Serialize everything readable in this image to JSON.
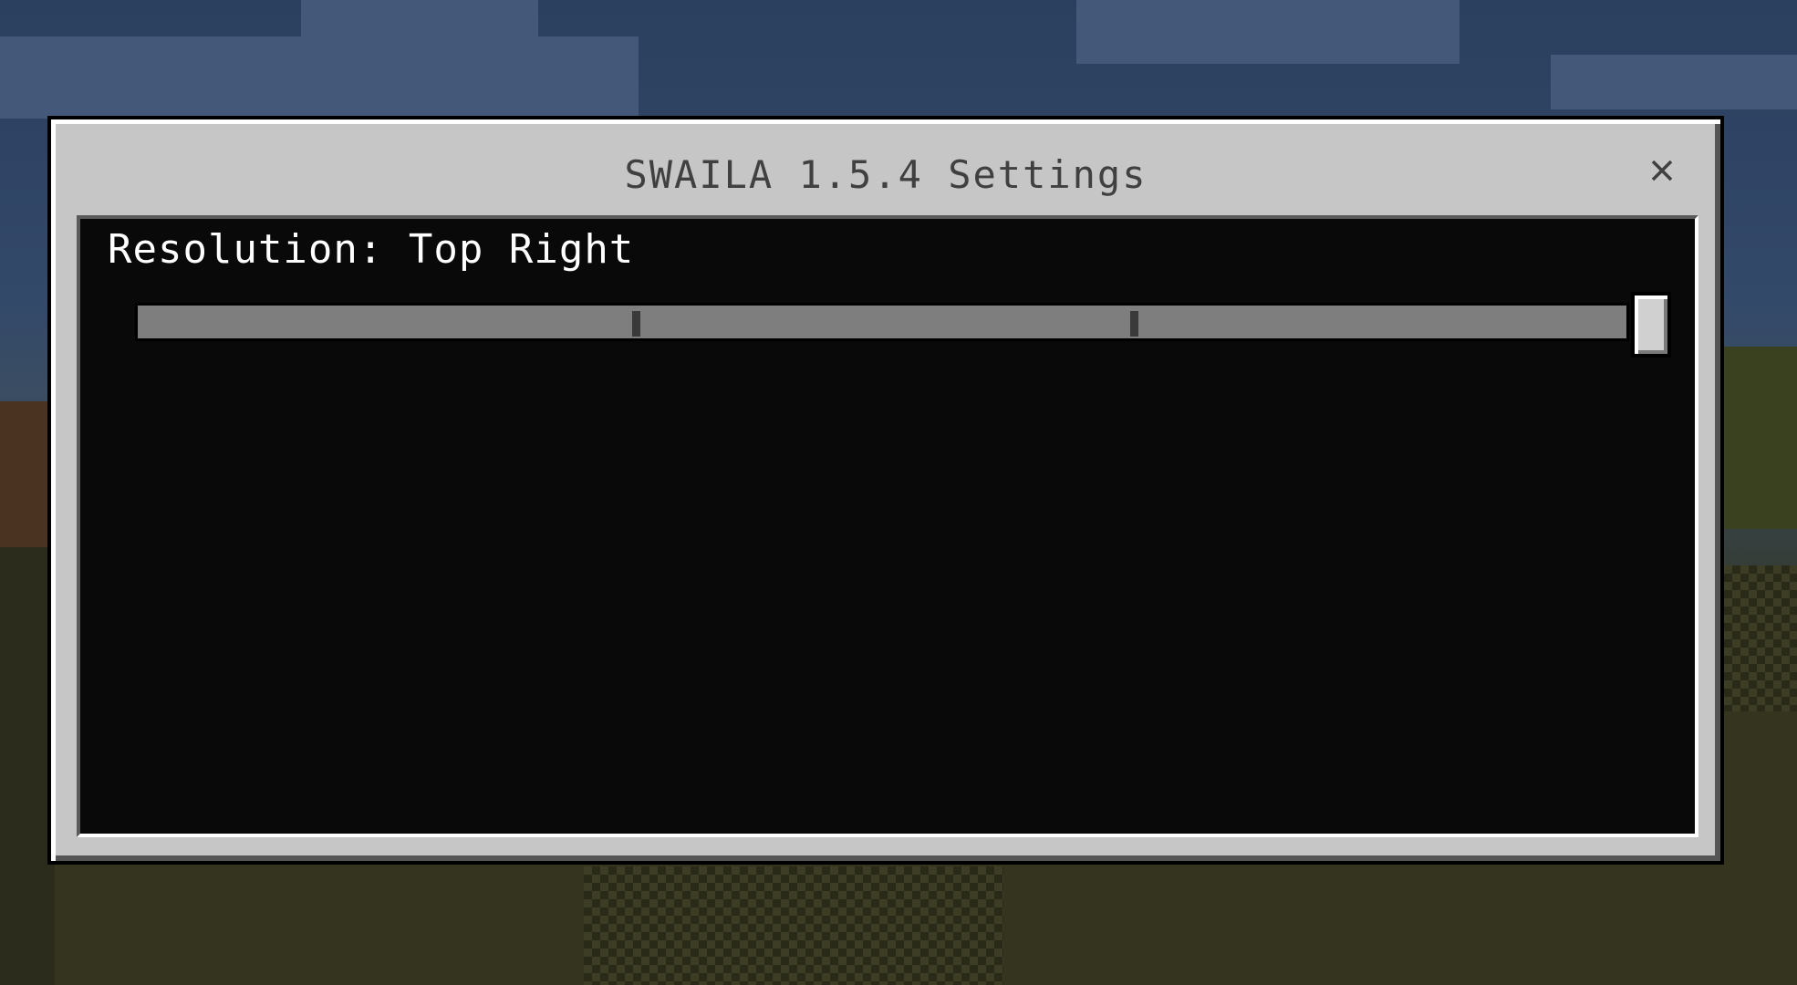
{
  "dialog": {
    "title": "SWAILA 1.5.4 Settings",
    "close_icon": "close-icon"
  },
  "setting": {
    "label": "Resolution: Top Right",
    "slider": {
      "steps": 4,
      "selected_index": 3,
      "value_fraction": 1.0
    }
  },
  "colors": {
    "dialog_bg": "#c6c6c6",
    "panel_bg": "#090909",
    "title_text": "#404040",
    "label_text": "#ffffff",
    "track": "#7e7e7e",
    "thumb": "#d0d0d0"
  }
}
